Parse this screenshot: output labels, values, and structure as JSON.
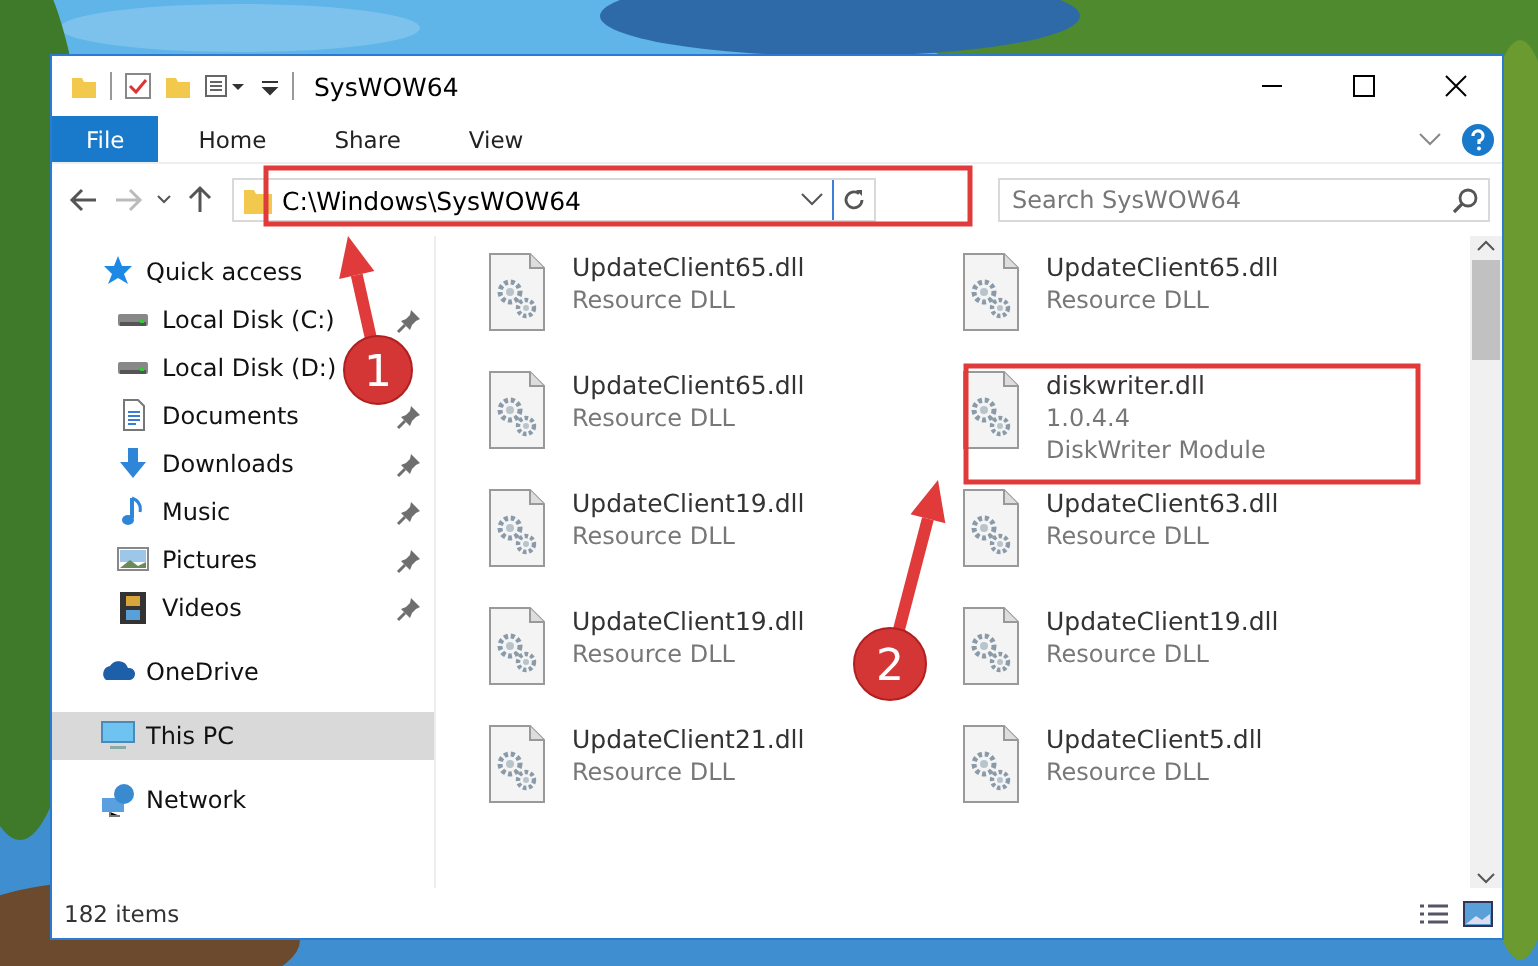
{
  "window": {
    "title": "SysWOW64"
  },
  "ribbon": {
    "tabs": [
      {
        "label": "File",
        "selected": true
      },
      {
        "label": "Home",
        "selected": false
      },
      {
        "label": "Share",
        "selected": false
      },
      {
        "label": "View",
        "selected": false
      }
    ]
  },
  "address_bar": {
    "path": "C:\\Windows\\SysWOW64"
  },
  "search": {
    "placeholder": "Search SysWOW64"
  },
  "sidebar": {
    "items": [
      {
        "label": "Quick access",
        "kind": "star",
        "selected": false,
        "children": [
          {
            "label": "Local Disk (C:)",
            "kind": "disk",
            "selected": false,
            "pinned": true
          },
          {
            "label": "Local Disk (D:)",
            "kind": "disk",
            "selected": false,
            "pinned": false
          },
          {
            "label": "Documents",
            "kind": "document",
            "selected": false,
            "pinned": true
          },
          {
            "label": "Downloads",
            "kind": "download",
            "selected": false,
            "pinned": true
          },
          {
            "label": "Music",
            "kind": "music",
            "selected": false,
            "pinned": true
          },
          {
            "label": "Pictures",
            "kind": "pictures",
            "selected": false,
            "pinned": true
          },
          {
            "label": "Videos",
            "kind": "video",
            "selected": false,
            "pinned": true
          }
        ]
      },
      {
        "label": "OneDrive",
        "kind": "cloud",
        "selected": false
      },
      {
        "label": "This PC",
        "kind": "pc",
        "selected": true
      },
      {
        "label": "Network",
        "kind": "network",
        "selected": false
      }
    ]
  },
  "files": [
    {
      "name": "UpdateClient65.dll",
      "type": "Resource DLL"
    },
    {
      "name": "UpdateClient65.dll",
      "type": "Resource DLL"
    },
    {
      "name": "UpdateClient65.dll",
      "type": "Resource DLL"
    },
    {
      "name": "diskwriter.dll",
      "version": "1.0.4.4",
      "type": "DiskWriter Module"
    },
    {
      "name": "UpdateClient19.dll",
      "type": "Resource DLL"
    },
    {
      "name": "UpdateClient63.dll",
      "type": "Resource DLL"
    },
    {
      "name": "UpdateClient19.dll",
      "type": "Resource DLL"
    },
    {
      "name": "UpdateClient19.dll",
      "type": "Resource DLL"
    },
    {
      "name": "UpdateClient21.dll",
      "type": "Resource DLL"
    },
    {
      "name": "UpdateClient5.dll",
      "type": "Resource DLL"
    }
  ],
  "status_bar": {
    "count": "182 items"
  },
  "annotations": [
    {
      "label": "1"
    },
    {
      "label": "2"
    }
  ]
}
